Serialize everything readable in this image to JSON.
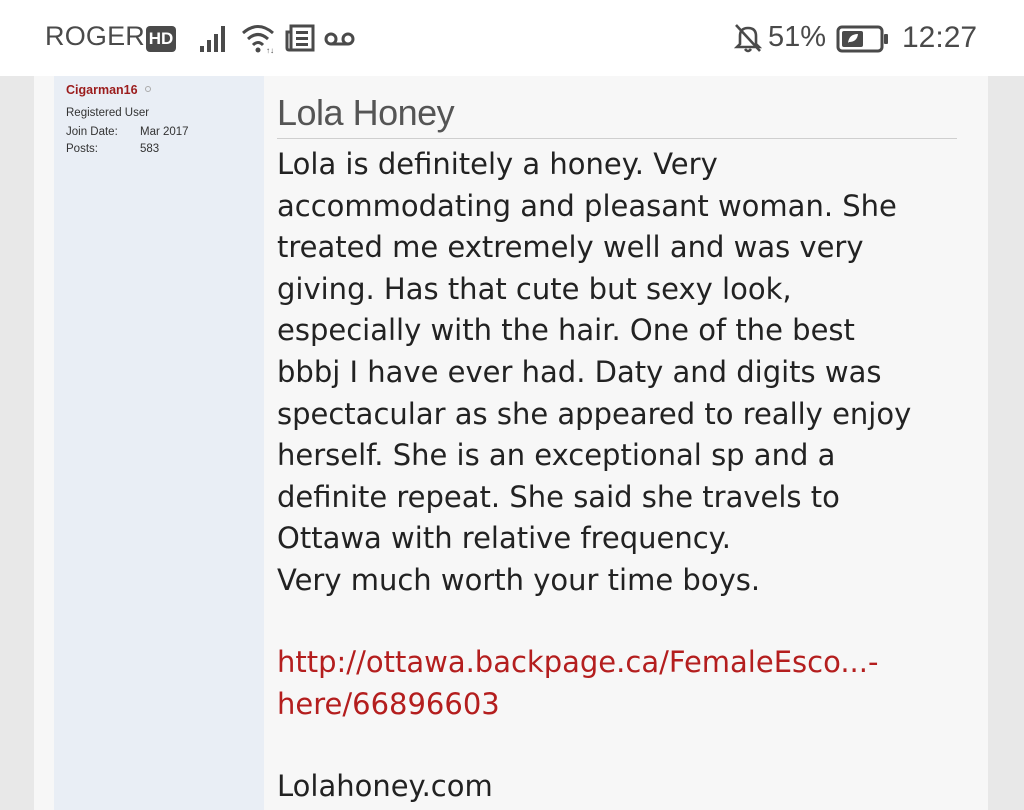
{
  "status_bar": {
    "carrier": "ROGERS",
    "network_badge": "HD",
    "icons": [
      "signal-icon",
      "wifi-icon",
      "news-icon",
      "voicemail-icon",
      "mute-bell-icon",
      "battery-icon"
    ],
    "battery_percent": "51%",
    "time": "12:27"
  },
  "post": {
    "author": {
      "username": "Cigarman16",
      "title": "Registered User",
      "join_date_label": "Join Date:",
      "join_date_value": "Mar 2017",
      "posts_label": "Posts:",
      "posts_value": "583"
    },
    "title": "Lola Honey",
    "body_lines": [
      "Lola is definitely a honey. Very",
      "accommodating and pleasant woman. She",
      "treated me extremely well and was very",
      "giving. Has that cute but sexy look,",
      "especially with the hair. One of the best",
      "bbbj I have ever had. Daty and digits was",
      "spectacular as she appeared to really enjoy",
      "herself. She is an exceptional sp and a",
      "definite repeat. She said she travels to",
      "Ottawa with relative frequency.",
      "Very much worth your time boys."
    ],
    "link_line1": "http://ottawa.backpage.ca/FemaleEsco...-",
    "link_line2": "here/66896603",
    "website": "Lolahoney.com"
  },
  "colors": {
    "username": "#9b1c1c",
    "link": "#b41e1e",
    "userinfo_bg": "#e9eef5",
    "post_bg": "#f7f7f7"
  }
}
